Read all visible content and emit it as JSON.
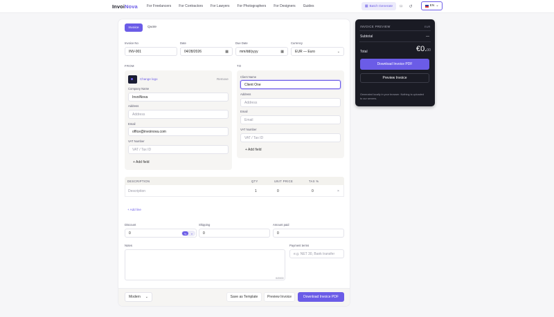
{
  "nav": {
    "logo_main": "Invoi",
    "logo_accent": "Nova",
    "links": [
      "For Freelancers",
      "For Contractors",
      "For Lawyers",
      "For Photographers",
      "For Designers",
      "Guides"
    ],
    "batch_label": "Batch Generate",
    "lang_label": "EN"
  },
  "tabs": {
    "invoice": "Invoice",
    "quote": "Quote"
  },
  "fields": {
    "invoice_no_label": "Invoice No",
    "invoice_no": "INV-001",
    "date_label": "Date",
    "date": "04/28/2026",
    "due_label": "Due Date",
    "due_placeholder": "mm/dd/yyyy",
    "currency_label": "Currency",
    "currency": "EUR — Euro"
  },
  "from": {
    "section": "FROM",
    "change_logo": "Change logo",
    "remove": "Remove",
    "company_label": "Company Name",
    "company": "InvoiNova",
    "address_label": "Address",
    "address_ph": "Address",
    "email_label": "Email",
    "email": "office@invoinova.com",
    "vat_label": "VAT Number",
    "vat_ph": "VAT / Tax ID",
    "add_field": "+ Add field"
  },
  "to": {
    "section": "TO",
    "client_label": "Client Name",
    "client": "Client One",
    "address_label": "Address",
    "address_ph": "Address",
    "email_label": "Email",
    "email_ph": "Email",
    "vat_label": "VAT Number",
    "vat_ph": "VAT / Tax ID",
    "add_field": "+ Add field"
  },
  "items": {
    "headers": {
      "desc": "DESCRIPTION",
      "qty": "QTY",
      "price": "UNIT PRICE",
      "tax": "TAX %"
    },
    "row": {
      "desc_ph": "Description",
      "qty": "1",
      "price": "0",
      "tax": "0",
      "remove": "×"
    },
    "add_line": "+ Add line"
  },
  "totals_inputs": {
    "discount_label": "Discount",
    "discount": "0",
    "pct": "%",
    "flat": "¤",
    "shipping_label": "Shipping",
    "shipping": "0",
    "paid_label": "Amount paid",
    "paid": "0"
  },
  "notes": {
    "label": "Notes",
    "counter": "0/2000",
    "terms_label": "Payment terms",
    "terms_ph": "e.g. NET 30, Bank transfer"
  },
  "footer": {
    "template": "Modern",
    "save": "Save as Template",
    "preview": "Preview Invoice",
    "download": "Download Invoice PDF"
  },
  "preview": {
    "title": "INVOICE PREVIEW",
    "currency": "EUR",
    "subtotal_label": "Subtotal",
    "subtotal": "—",
    "total_label": "Total",
    "total_main": "€0.",
    "total_cents": "00",
    "download": "Download Invoice PDF",
    "preview": "Preview Invoice",
    "note": "Generated locally in your browser. Nothing is uploaded to our servers."
  },
  "colors": {
    "accent": "#6b5ce7",
    "dark_panel": "#1a1b24"
  }
}
